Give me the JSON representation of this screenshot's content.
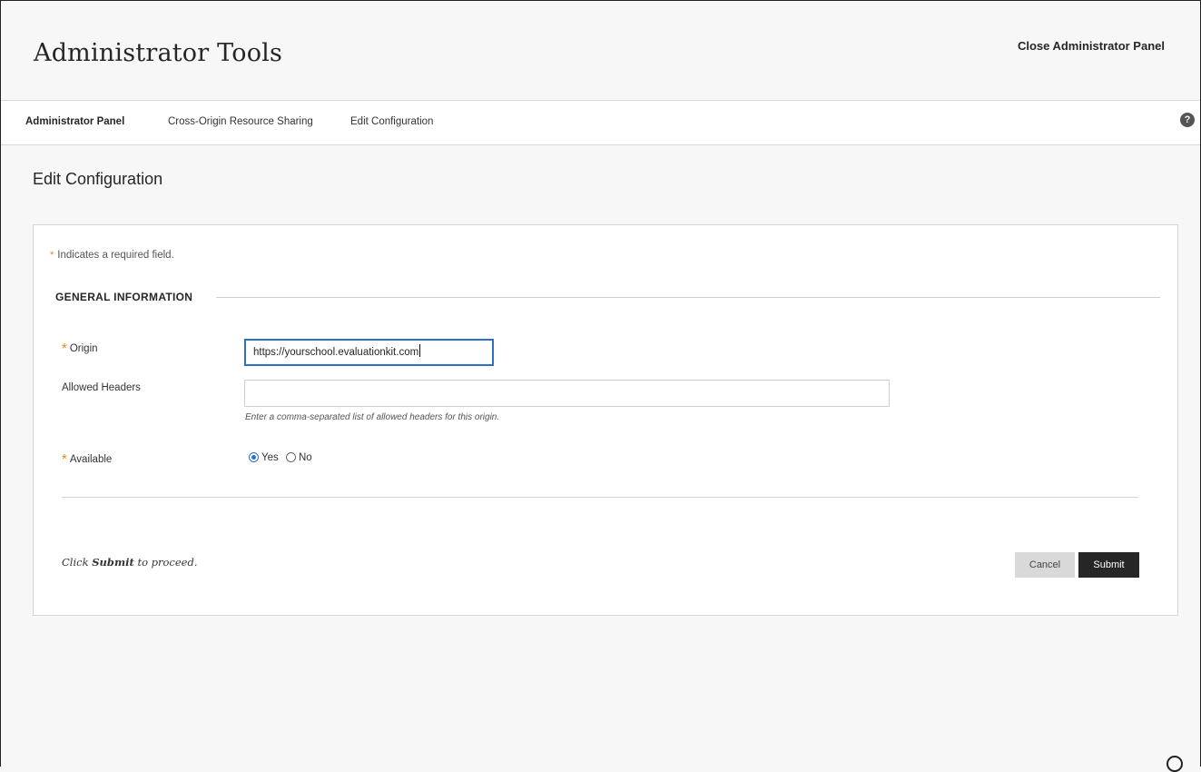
{
  "header": {
    "title": "Administrator Tools",
    "close_label": "Close Administrator Panel"
  },
  "breadcrumb": {
    "items": [
      "Administrator Panel",
      "Cross-Origin Resource Sharing",
      "Edit Configuration"
    ],
    "help_icon": "question-circle-icon"
  },
  "page": {
    "title": "Edit Configuration"
  },
  "form": {
    "required_note": "Indicates a required field.",
    "required_marker": "*",
    "section_title": "GENERAL INFORMATION",
    "origin": {
      "label": "Origin",
      "value": "https://yourschool.evaluationkit.com"
    },
    "allowed_headers": {
      "label": "Allowed Headers",
      "value": "",
      "hint": "Enter a comma-separated list of allowed headers for this origin."
    },
    "available": {
      "label": "Available",
      "options": [
        "Yes",
        "No"
      ],
      "selected": "Yes"
    },
    "proceed_prefix": "Click ",
    "proceed_bold": "Submit",
    "proceed_suffix": " to proceed.",
    "cancel_label": "Cancel",
    "submit_label": "Submit"
  },
  "colors": {
    "accent_blue": "#2d6fc7",
    "required_orange": "#e8851a",
    "submit_bg": "#262626",
    "cancel_bg": "#d9d9d9"
  }
}
